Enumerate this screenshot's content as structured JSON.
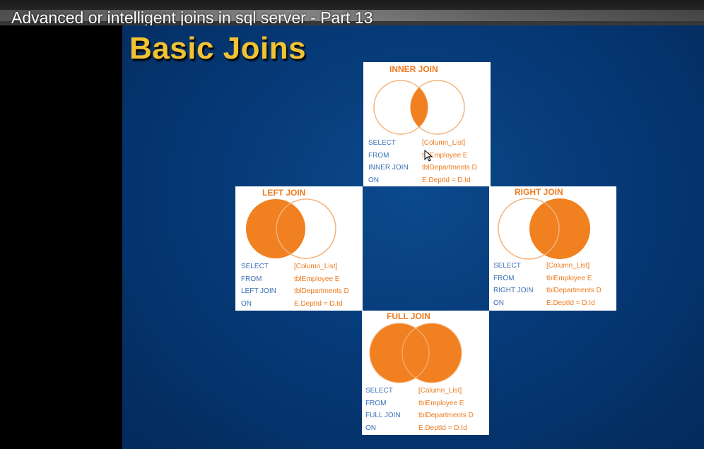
{
  "video": {
    "title": "Advanced or intelligent joins in sql server - Part 13"
  },
  "slide": {
    "title": "Basic Joins"
  },
  "colors": {
    "accent": "#ee7a1e",
    "keyword": "#3b6fb6",
    "title": "#f1c232"
  },
  "joins": {
    "inner": {
      "title": "INNER JOIN",
      "select": "SELECT",
      "select_val": "[Column_List]",
      "from": "FROM",
      "from_val": "tblEmployee E",
      "join": "INNER JOIN",
      "join_val": "tblDepartments D",
      "on": "ON",
      "on_val": "E.DeptId = D.Id"
    },
    "left": {
      "title": "LEFT JOIN",
      "select": "SELECT",
      "select_val": "[Column_List]",
      "from": "FROM",
      "from_val": "tblEmployee E",
      "join": "LEFT JOIN",
      "join_val": "tblDepartments D",
      "on": "ON",
      "on_val": "E.DeptId = D.Id"
    },
    "right": {
      "title": "RIGHT JOIN",
      "select": "SELECT",
      "select_val": "[Column_List]",
      "from": "FROM",
      "from_val": "tblEmployee E",
      "join": "RIGHT JOIN",
      "join_val": "tblDepartments D",
      "on": "ON",
      "on_val": "E.DeptId = D.Id"
    },
    "full": {
      "title": "FULL JOIN",
      "select": "SELECT",
      "select_val": "[Column_List]",
      "from": "FROM",
      "from_val": "tblEmployee E",
      "join": "FULL JOIN",
      "join_val": "tblDepartments D",
      "on": "ON",
      "on_val": "E.DeptId = D.Id"
    }
  }
}
